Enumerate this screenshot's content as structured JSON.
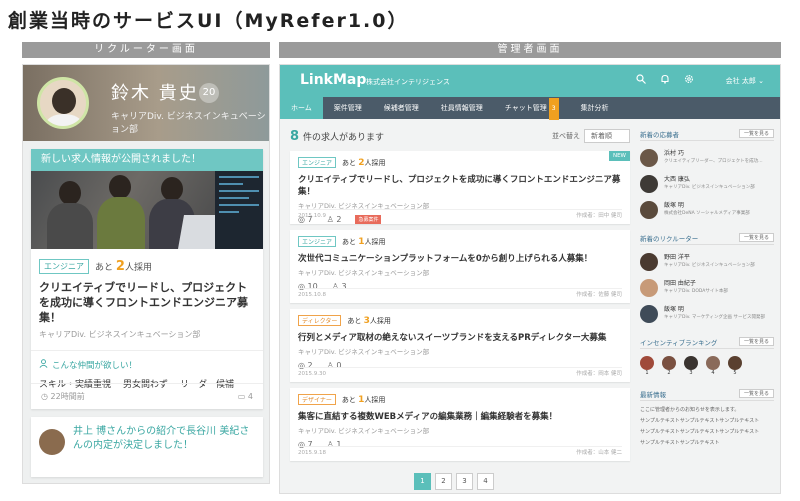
{
  "slide": {
    "title": "創業当時のサービスUI（MyRefer1.0）",
    "left_label": "リクルーター画面",
    "right_label": "管理者画面"
  },
  "recruiter": {
    "profile": {
      "name": "鈴木 貴史",
      "badge": "20",
      "dept": "キャリアDiv. ビジネスインキュベーション部"
    },
    "notice": "新しい求人情報が公開されました！",
    "job": {
      "tag": "エンジニア",
      "count_prefix": "あと",
      "count": "2",
      "count_suffix": "人採用",
      "title": "クリエイティブでリードし、プロジェクトを成功に導くフロントエンドエンジニア募集！",
      "dept": "キャリアDiv. ビジネスインキュベーション部",
      "want_head": "こんな仲間が欲しい！",
      "wants": [
        "スキル・実績重視",
        "男女問わず",
        "リーダー候補"
      ],
      "time": "22時間前",
      "comments": "4"
    },
    "news": "井上 博さんからの紹介で長谷川 美紀さんの内定が決定しました！"
  },
  "admin": {
    "logo": "LinkMap",
    "company": "株式会社インテリジェンス",
    "user": "会社 太郎",
    "nav": [
      {
        "label": "ホーム",
        "active": true
      },
      {
        "label": "案件管理"
      },
      {
        "label": "候補者管理"
      },
      {
        "label": "社員情報管理"
      },
      {
        "label": "チャット管理",
        "badge": "3"
      },
      {
        "label": "集計分析"
      }
    ],
    "count_num": "8",
    "count_text": "件の求人があります",
    "sort_label": "並べ替え",
    "sort_value": "新着順",
    "jobs": [
      {
        "tag": "エンジニア",
        "count": "2",
        "title": "クリエイティブでリードし、プロジェクトを成功に導くフロントエンドエンジニア募集！",
        "dept": "キャリアDiv. ビジネスインキュベーション部",
        "views": "7",
        "refs": "2",
        "hot": "急募案件",
        "new": "NEW",
        "date": "2015.10.9",
        "author": "作成者：田中 健司"
      },
      {
        "tag": "エンジニア",
        "count": "1",
        "title": "次世代コミュニケーションプラットフォームを0から創り上げられる人募集！",
        "dept": "キャリアDiv. ビジネスインキュベーション部",
        "views": "10",
        "refs": "3",
        "date": "2015.10.8",
        "author": "作成者：佐藤 健司"
      },
      {
        "tag": "ディレクター",
        "count": "3",
        "title": "行列とメディア取材の絶えないスイーツブランドを支えるPRディレクター大募集",
        "dept": "キャリアDiv. ビジネスインキュベーション部",
        "views": "2",
        "refs": "0",
        "date": "2015.9.30",
        "author": "作成者：岡本 健司"
      },
      {
        "tag": "デザイナー",
        "count": "1",
        "title": "集客に直結する複数WEBメディアの編集業務｜編集経験者を募集！",
        "dept": "キャリアDiv. ビジネスインキュベーション部",
        "views": "7",
        "refs": "1",
        "date": "2015.9.18",
        "author": "作成者：山本 健二"
      }
    ],
    "pages": [
      "1",
      "2",
      "3",
      "4"
    ],
    "side": {
      "applicants": {
        "head": "新着の応募者",
        "more": "一覧を見る",
        "people": [
          {
            "name": "浜村 巧",
            "sub": "クリエイティブリーダー、プロジェクトを成功…"
          },
          {
            "name": "大西 康弘",
            "sub": "キャリアDiv. ビジネスインキュベーション部"
          },
          {
            "name": "飯塚 明",
            "sub": "株式会社DeNA ソーシャルメディア事業部"
          }
        ]
      },
      "recruiters": {
        "head": "新着のリクルーター",
        "more": "一覧を見る",
        "people": [
          {
            "name": "野田 洋平",
            "sub": "キャリアDiv. ビジネスインキュベーション部"
          },
          {
            "name": "岡田 由紀子",
            "sub": "キャリアDiv. DODAサイト本部"
          },
          {
            "name": "飯塚 明",
            "sub": "キャリアDiv. マーケティング企画 サービス開発部"
          }
        ]
      },
      "ranking": {
        "head": "インセンティブランキング",
        "more": "一覧を見る",
        "ranks": [
          "1",
          "2",
          "3",
          "4",
          "5"
        ]
      },
      "info": {
        "head": "最新情報",
        "more": "一覧を見る",
        "lines": [
          "ここに管理者からのお知らせを表示します。",
          "サンプルテキストサンプルテキストサンプルテキスト",
          "サンプルテキストサンプルテキストサンプルテキスト",
          "サンプルテキストサンプルテキスト"
        ]
      }
    }
  }
}
